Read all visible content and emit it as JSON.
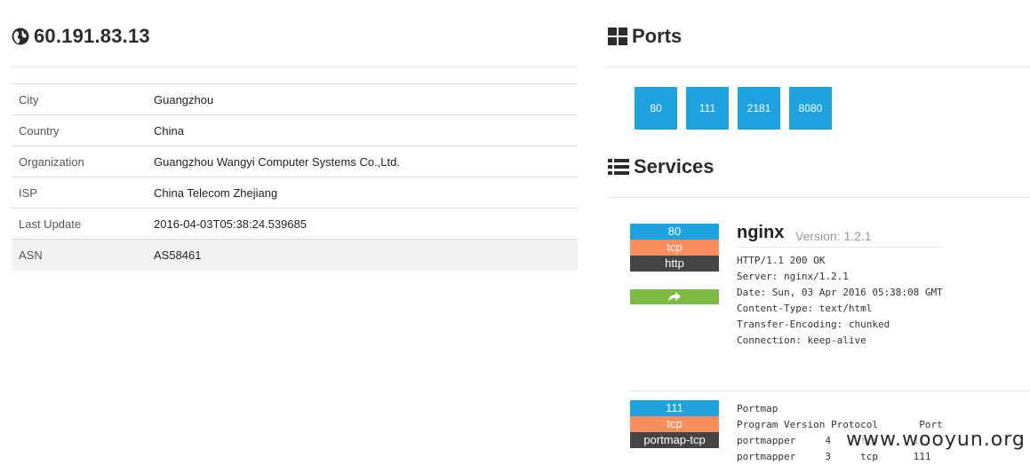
{
  "host": {
    "ip": "60.191.83.13"
  },
  "info_rows": [
    {
      "key": "City",
      "value": "Guangzhou"
    },
    {
      "key": "Country",
      "value": "China"
    },
    {
      "key": "Organization",
      "value": "Guangzhou Wangyi Computer Systems Co.,Ltd."
    },
    {
      "key": "ISP",
      "value": "China Telecom Zhejiang"
    },
    {
      "key": "Last Update",
      "value": "2016-04-03T05:38:24.539685"
    },
    {
      "key": "ASN",
      "value": "AS58461"
    }
  ],
  "ports": {
    "title": "Ports",
    "items": [
      "80",
      "111",
      "2181",
      "8080"
    ]
  },
  "services": {
    "title": "Services",
    "nginx": {
      "port": "80",
      "protocol": "tcp",
      "module": "http",
      "product": "nginx",
      "version_label": "Version: 1.2.1",
      "banner": [
        "HTTP/1.1 200 OK",
        "Server: nginx/1.2.1",
        "Date: Sun, 03 Apr 2016 05:38:08 GMT",
        "Content-Type: text/html",
        "Transfer-Encoding: chunked",
        "Connection: keep-alive"
      ]
    },
    "portmap": {
      "port": "111",
      "protocol": "tcp",
      "module": "portmap-tcp",
      "banner": [
        "Portmap",
        "Program Version Protocol       Port",
        "portmapper     4     tcp      111",
        "portmapper     3     tcp      111"
      ]
    }
  },
  "watermark": "www.wooyun.org",
  "colors": {
    "port_blue": "#1ea3e0",
    "proto_orange": "#f98d5c",
    "module_dark": "#444444",
    "share_green": "#7dbc44"
  }
}
